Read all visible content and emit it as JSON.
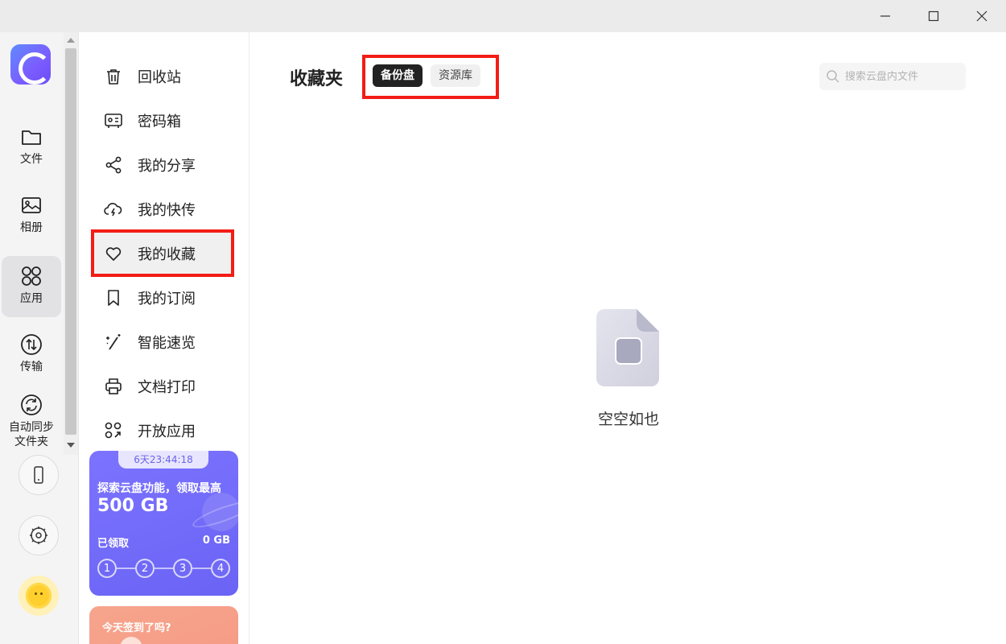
{
  "window": {
    "minimize_icon": "minimize-icon",
    "maximize_icon": "maximize-icon",
    "close_icon": "close-icon"
  },
  "rail": {
    "items": [
      {
        "label": "文件",
        "icon": "folder-icon"
      },
      {
        "label": "相册",
        "icon": "photo-icon"
      },
      {
        "label": "应用",
        "icon": "apps-icon"
      },
      {
        "label": "传输",
        "icon": "transfer-icon"
      },
      {
        "label": "自动同步\n文件夹",
        "label_line1": "自动同步",
        "label_line2": "文件夹",
        "icon": "sync-icon"
      }
    ]
  },
  "sidebar": {
    "items": [
      {
        "label": "回收站",
        "icon": "trash-icon"
      },
      {
        "label": "密码箱",
        "icon": "safe-icon"
      },
      {
        "label": "我的分享",
        "icon": "share-icon"
      },
      {
        "label": "我的快传",
        "icon": "cloud-bolt-icon"
      },
      {
        "label": "我的收藏",
        "icon": "heart-icon"
      },
      {
        "label": "我的订阅",
        "icon": "bookmark-icon"
      },
      {
        "label": "智能速览",
        "icon": "magic-wand-icon"
      },
      {
        "label": "文档打印",
        "icon": "printer-icon"
      },
      {
        "label": "开放应用",
        "icon": "open-apps-icon"
      }
    ]
  },
  "promo": {
    "timer": "6天23:44:18",
    "line1": "探索云盘功能，领取最高",
    "line2": "500 GB",
    "got_label": "已领取",
    "got_value": "0 GB",
    "steps": [
      "1",
      "2",
      "3",
      "4"
    ]
  },
  "signin": {
    "text": "今天签到了吗?"
  },
  "main": {
    "title": "收藏夹",
    "tabs": [
      {
        "label": "备份盘"
      },
      {
        "label": "资源库"
      }
    ],
    "search_placeholder": "搜索云盘内文件",
    "empty_text": "空空如也"
  },
  "colors": {
    "highlight": "#f21d16",
    "accent": "#6a63f4",
    "tab_active": "#222222"
  }
}
